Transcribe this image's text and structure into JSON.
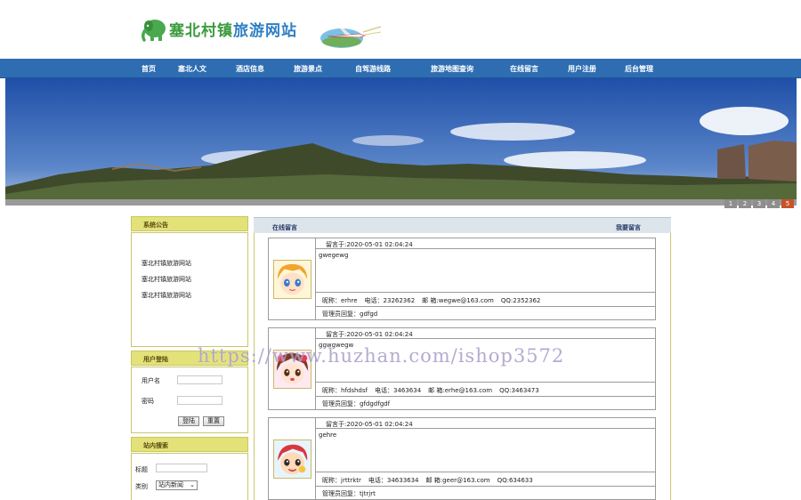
{
  "site": {
    "title_part1": "塞北村镇",
    "title_part2": "旅游网站"
  },
  "nav": {
    "items": [
      "首页",
      "塞北人文",
      "酒店信息",
      "旅游景点",
      "自驾游线路",
      "旅游地图查询",
      "在线留言",
      "用户注册",
      "后台管理"
    ]
  },
  "banner": {
    "pages": [
      "1",
      "2",
      "3",
      "4",
      "5"
    ],
    "active_page": "5"
  },
  "notice": {
    "heading": "系统公告",
    "items": [
      "塞北村镇旅游网站",
      "塞北村镇旅游网站",
      "塞北村镇旅游网站"
    ]
  },
  "login": {
    "heading": "用户登陆",
    "username_label": "用户名",
    "password_label": "密码",
    "username_value": "",
    "password_value": "",
    "login_button": "登陆",
    "reset_button": "重置"
  },
  "search": {
    "heading": "站内搜索",
    "title_label": "标题",
    "title_value": "",
    "category_label": "类别",
    "category_selected": "站内新闻"
  },
  "messages": {
    "heading": "在线留言",
    "write_link": "我要留言",
    "list": [
      {
        "time": "留言于:2020-05-01 02:04:24",
        "content": "gwegewg",
        "nickname": "昵称：erhre",
        "phone": "电话：23262362",
        "email": "邮 箱:wegwe@163.com",
        "qq": "QQ:2352362",
        "reply": "管理员回复：gdfgd"
      },
      {
        "time": "留言于:2020-05-01 02:04:24",
        "content": "ggwgwegw",
        "nickname": "昵称：hfdshdsf",
        "phone": "电话：3463634",
        "email": "邮 箱:erhe@163.com",
        "qq": "QQ:3463473",
        "reply": "管理员回复：gfdgdfgdf"
      },
      {
        "time": "留言于:2020-05-01 02:04:24",
        "content": "gehre",
        "nickname": "昵称：jrttrktr",
        "phone": "电话：34633634",
        "email": "邮 箱:geer@163.com",
        "qq": "QQ:634633",
        "reply": "管理员回复：tjtrjrt"
      }
    ]
  },
  "watermark": "https://www.huzhan.com/ishop3572"
}
